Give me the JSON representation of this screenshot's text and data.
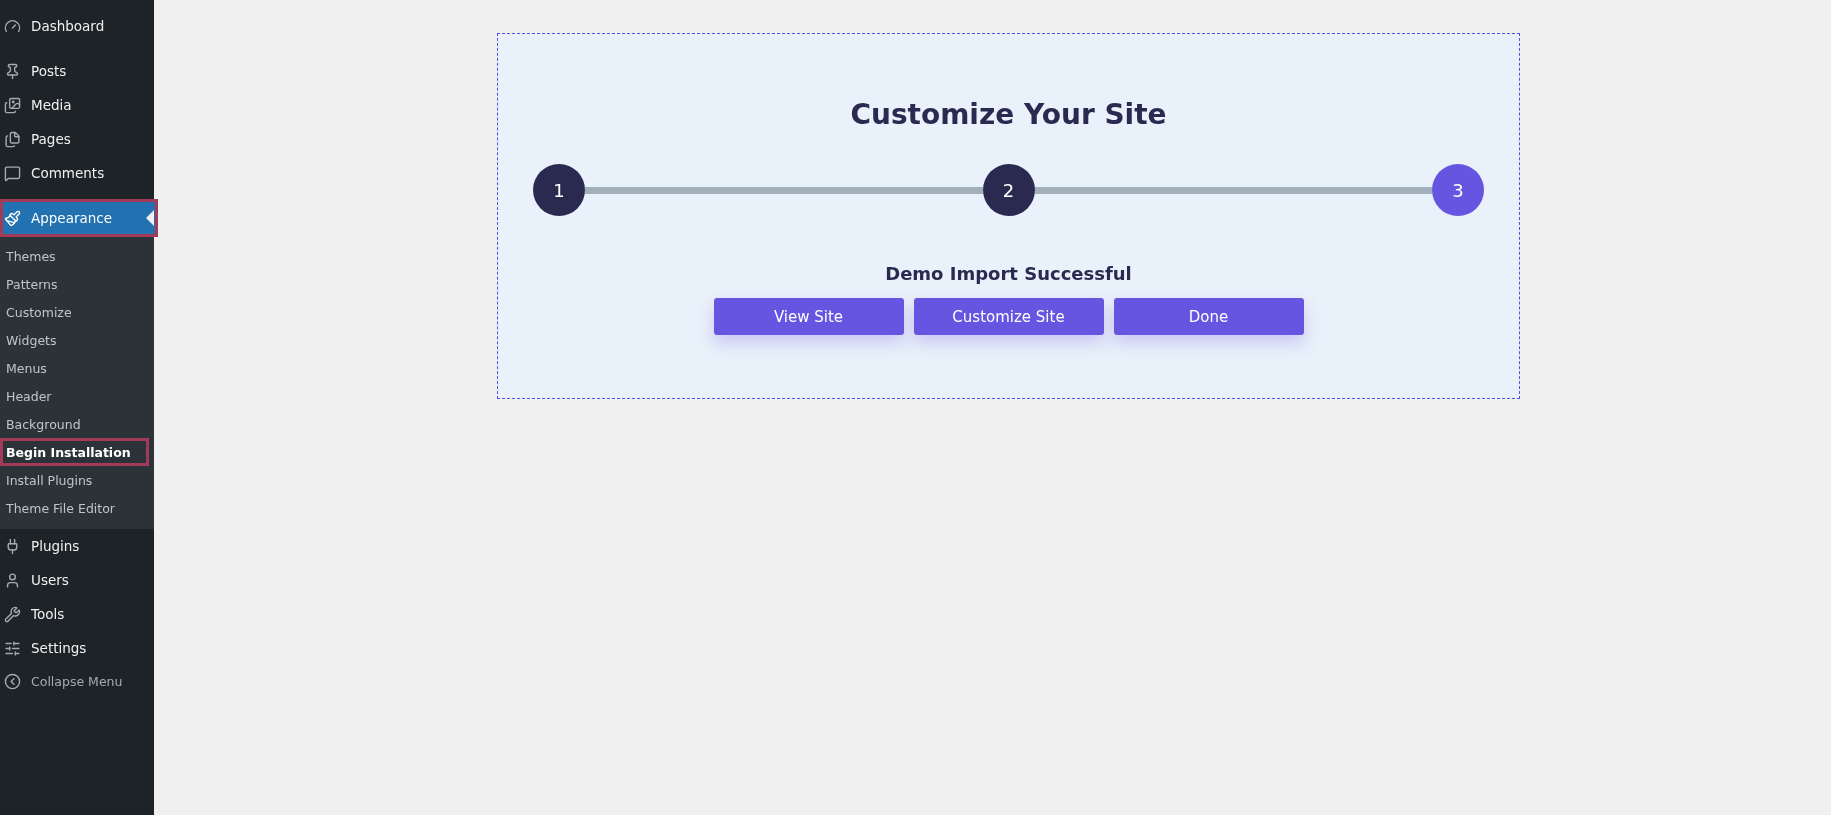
{
  "sidebar": {
    "groups": [
      [
        {
          "label": "Dashboard",
          "current": false,
          "highlighted": false
        }
      ],
      [
        {
          "label": "Posts",
          "current": false,
          "highlighted": false
        },
        {
          "label": "Media",
          "current": false,
          "highlighted": false
        },
        {
          "label": "Pages",
          "current": false,
          "highlighted": false
        },
        {
          "label": "Comments",
          "current": false,
          "highlighted": false
        }
      ],
      [
        {
          "label": "Appearance",
          "current": true,
          "highlighted": true,
          "expanded": true,
          "children": [
            {
              "label": "Themes",
              "current": false,
              "highlighted": false
            },
            {
              "label": "Patterns",
              "current": false,
              "highlighted": false
            },
            {
              "label": "Customize",
              "current": false,
              "highlighted": false
            },
            {
              "label": "Widgets",
              "current": false,
              "highlighted": false
            },
            {
              "label": "Menus",
              "current": false,
              "highlighted": false
            },
            {
              "label": "Header",
              "current": false,
              "highlighted": false
            },
            {
              "label": "Background",
              "current": false,
              "highlighted": false
            },
            {
              "label": "Begin Installation",
              "current": true,
              "highlighted": true
            },
            {
              "label": "Install Plugins",
              "current": false,
              "highlighted": false
            },
            {
              "label": "Theme File Editor",
              "current": false,
              "highlighted": false
            }
          ]
        },
        {
          "label": "Plugins",
          "current": false,
          "highlighted": false
        },
        {
          "label": "Users",
          "current": false,
          "highlighted": false
        },
        {
          "label": "Tools",
          "current": false,
          "highlighted": false
        },
        {
          "label": "Settings",
          "current": false,
          "highlighted": false
        }
      ]
    ],
    "collapse": "Collapse Menu"
  },
  "wizard": {
    "title": "Customize Your Site",
    "steps": [
      {
        "label": "1",
        "selected": false
      },
      {
        "label": "2",
        "selected": false
      },
      {
        "label": "3",
        "selected": true
      }
    ],
    "message": "Demo Import Successful",
    "buttons": [
      "View Site",
      "Customize Site",
      "Done"
    ]
  }
}
